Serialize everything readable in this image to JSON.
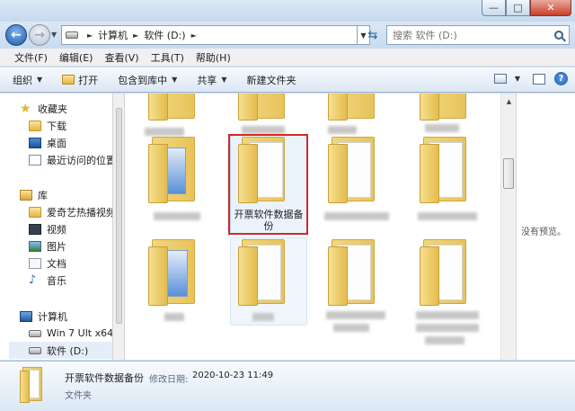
{
  "window": {
    "buttons": {
      "minimize": "—",
      "maximize": "□",
      "close": "✕"
    }
  },
  "address": {
    "crumbs": [
      "计算机",
      "软件 (D:)"
    ],
    "search_placeholder": "搜索 软件 (D:)"
  },
  "menu": [
    "文件(F)",
    "编辑(E)",
    "查看(V)",
    "工具(T)",
    "帮助(H)"
  ],
  "toolbar": {
    "organize": "组织",
    "open": "打开",
    "include_library": "包含到库中",
    "share": "共享",
    "new_folder": "新建文件夹"
  },
  "nav": {
    "favorites": {
      "title": "收藏夹",
      "items": [
        "下载",
        "桌面",
        "最近访问的位置"
      ]
    },
    "libraries": {
      "title": "库",
      "items": [
        "爱奇艺热播视频",
        "视频",
        "图片",
        "文档",
        "音乐"
      ]
    },
    "computer": {
      "title": "计算机",
      "items": [
        "Win 7 Ult x64 (C",
        "软件 (D:)"
      ]
    }
  },
  "selected_folder": {
    "name": "开票软件数据备份"
  },
  "preview": {
    "text": "没有预览。"
  },
  "details": {
    "name": "开票软件数据备份",
    "modified_label": "修改日期:",
    "modified_value": "2020-10-23 11:49",
    "type": "文件夹"
  },
  "icons": {
    "back": "back-arrow-icon",
    "forward": "forward-arrow-icon",
    "refresh": "refresh-icon",
    "search": "search-icon",
    "favorites": "star-icon",
    "help": "help-icon"
  },
  "colors": {
    "selection_border": "#d42727",
    "folder": "#e8c35c",
    "highlight": "#eaf3fc"
  }
}
